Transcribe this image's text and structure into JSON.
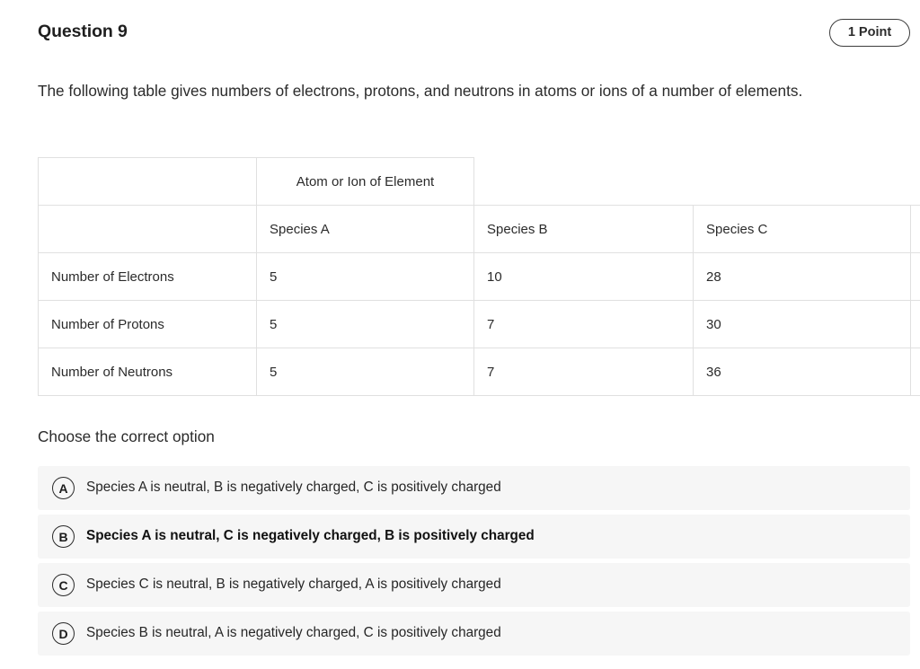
{
  "header": {
    "question_title": "Question 9",
    "points_badge": "1 Point"
  },
  "prompt": "The following table gives numbers of electrons, protons, and neutrons in atoms or ions of a number of elements.",
  "table": {
    "group_header": "Atom or Ion of Element",
    "species_headers": [
      "Species A",
      "Species B",
      "Species C",
      ""
    ],
    "rows": [
      {
        "label": "Number of Electrons",
        "values": [
          "5",
          "10",
          "28",
          ""
        ]
      },
      {
        "label": "Number of Protons",
        "values": [
          "5",
          "7",
          "30",
          ""
        ]
      },
      {
        "label": "Number of Neutrons",
        "values": [
          "5",
          "7",
          "36",
          ""
        ]
      }
    ],
    "corner_label": ""
  },
  "choose_label": "Choose the correct option",
  "options": [
    {
      "letter": "A",
      "text": "Species A is neutral, B is negatively charged, C is positively charged",
      "selected": false
    },
    {
      "letter": "B",
      "text": "Species A is neutral, C is negatively charged, B is positively charged",
      "selected": true
    },
    {
      "letter": "C",
      "text": "Species C is neutral, B is negatively charged, A is positively charged",
      "selected": false
    },
    {
      "letter": "D",
      "text": "Species B is neutral, A is negatively charged, C is positively charged",
      "selected": false
    }
  ],
  "colors": {
    "page_background": "#ffffff",
    "text": "#2b2b2b",
    "option_background": "#f6f6f6",
    "table_border": "#e0e0e0",
    "badge_border": "#3c3c3c"
  }
}
